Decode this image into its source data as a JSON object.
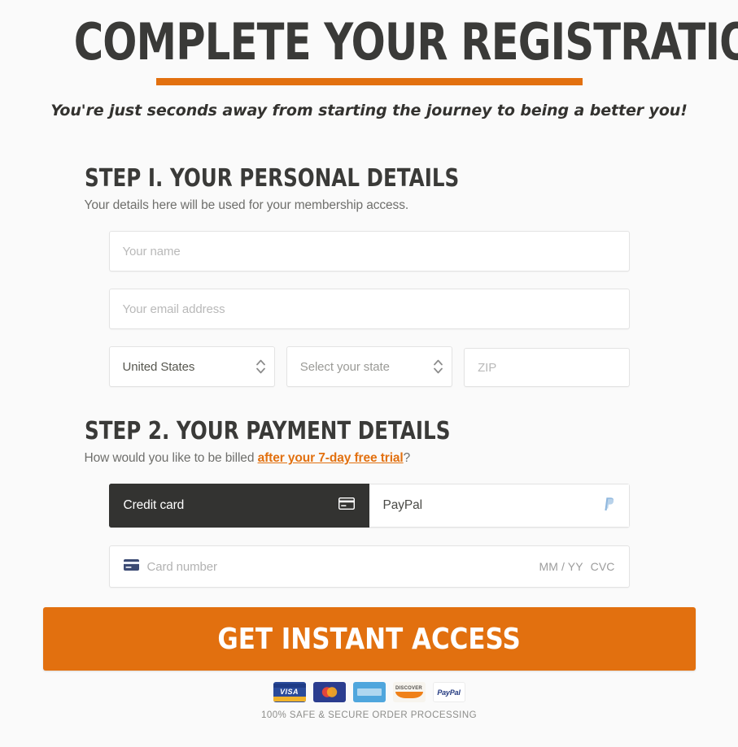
{
  "colors": {
    "accent_orange": "#e2700f",
    "dark": "#333331",
    "page_bg": "#fafafa",
    "muted_text": "#6f6f6c",
    "placeholder": "#b9b9b9"
  },
  "hero": {
    "title": "COMPLETE YOUR REGISTRATION",
    "subtitle": "You're just seconds away from starting the journey to being a better you!"
  },
  "step1": {
    "heading": "STEP I. YOUR PERSONAL DETAILS",
    "subtitle": "Your details here will be used for your membership access.",
    "name_placeholder": "Your name",
    "email_placeholder": "Your email address",
    "country_value": "United States",
    "state_value": "Select your state",
    "zip_placeholder": "ZIP"
  },
  "step2": {
    "heading": "STEP 2. YOUR PAYMENT DETAILS",
    "subtitle_before": "How would you like to be billed ",
    "subtitle_link": "after your 7-day free trial",
    "subtitle_after": "?",
    "tab_credit_card": "Credit card",
    "tab_paypal": "PayPal",
    "card_number_placeholder": "Card number",
    "expiry_placeholder": "MM / YY",
    "cvc_placeholder": "CVC"
  },
  "cta": {
    "label": "GET INSTANT ACCESS"
  },
  "footer": {
    "secure_text": "100% SAFE & SECURE ORDER PROCESSING",
    "badges": [
      {
        "name": "visa",
        "label": "VISA"
      },
      {
        "name": "mastercard",
        "label": ""
      },
      {
        "name": "amex",
        "label": ""
      },
      {
        "name": "discover",
        "label": "DISCOVER"
      },
      {
        "name": "paypal",
        "label": "PayPal"
      }
    ]
  }
}
